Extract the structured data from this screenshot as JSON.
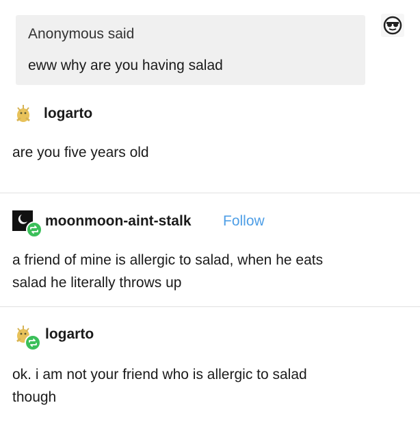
{
  "ask": {
    "sender": "Anonymous said",
    "text": "eww why are you having salad"
  },
  "posts": [
    {
      "username": "logarto",
      "text_lines": [
        "are you five years old"
      ]
    },
    {
      "username": "moonmoon-aint-stalk",
      "follow_label": "Follow",
      "text_lines": [
        "a friend of mine is allergic to salad, when he eats",
        "salad he literally throws up"
      ]
    },
    {
      "username": "logarto",
      "text_lines": [
        "ok. i am not your friend who is allergic to salad",
        "though"
      ]
    }
  ],
  "icons": {
    "corner": "sunglasses-emoji-icon",
    "logarto_avatar": "lizard-avatar-icon",
    "moonmoon_avatar": "moon-avatar-icon",
    "reblog": "reblog-icon"
  },
  "colors": {
    "follow": "#4e9ee6",
    "reblog_badge": "#3bbf5a",
    "ask_background": "#f0f0f0"
  }
}
